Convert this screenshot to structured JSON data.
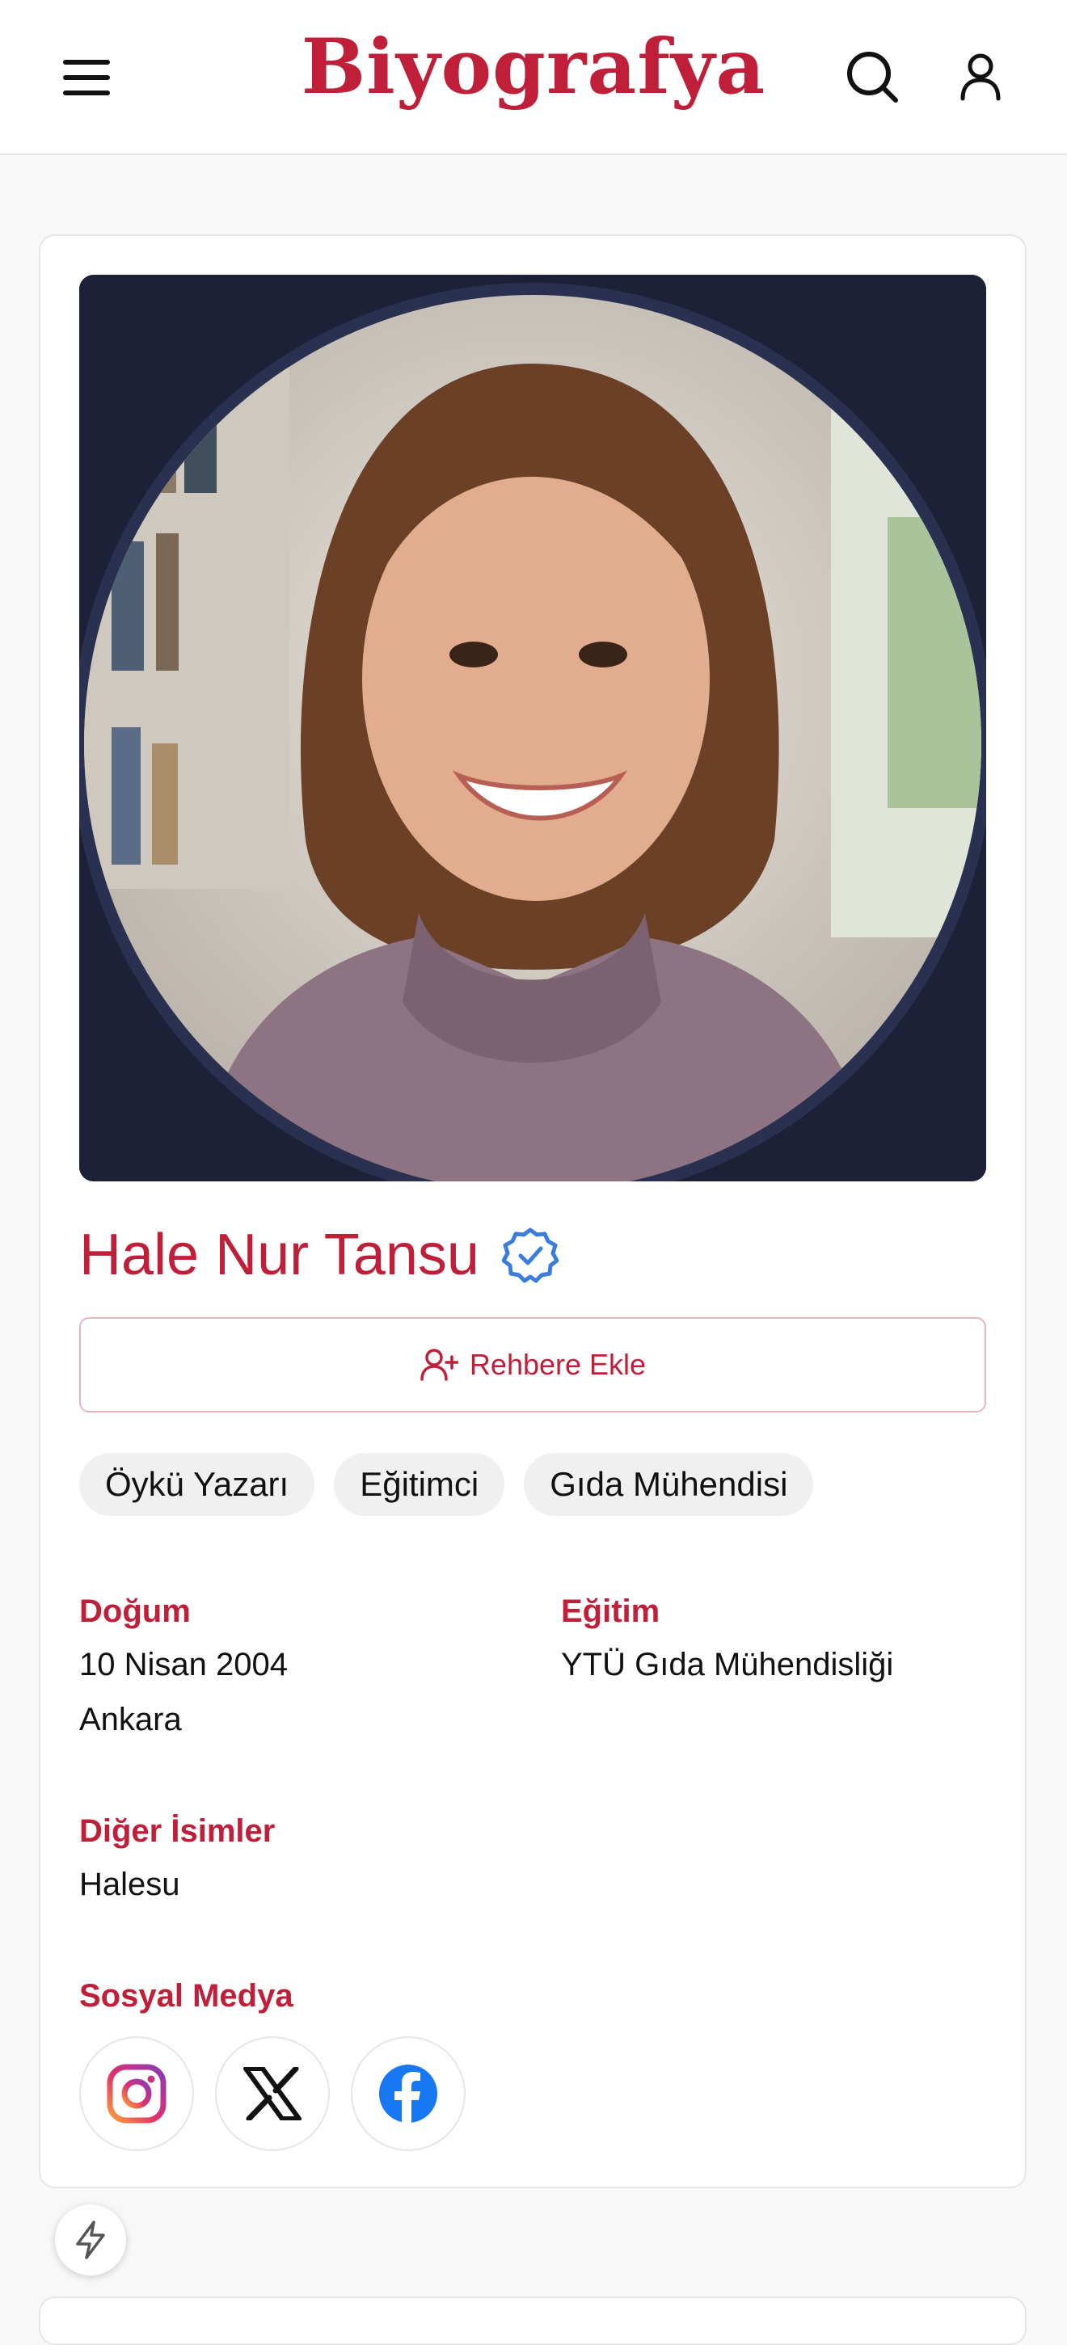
{
  "header": {
    "logo_text": "Biyografya",
    "menu_icon": "hamburger-menu-icon",
    "search_icon": "search-icon",
    "profile_icon": "user-icon"
  },
  "profile": {
    "name": "Hale Nur Tansu",
    "verified_icon": "verified-badge-icon",
    "add_contact_label": "Rehbere Ekle",
    "add_contact_icon": "user-plus-icon",
    "tags": [
      "Öykü Yazarı",
      "Eğitimci",
      "Gıda Mühendisi"
    ],
    "birth": {
      "label": "Doğum",
      "date": "10 Nisan 2004",
      "place": "Ankara"
    },
    "education": {
      "label": "Eğitim",
      "value": "YTÜ Gıda Mühendisliği"
    },
    "other_names": {
      "label": "Diğer İsimler",
      "value": "Halesu"
    },
    "social": {
      "label": "Sosyal Medya",
      "items": [
        {
          "name": "Instagram",
          "icon": "instagram-icon"
        },
        {
          "name": "X",
          "icon": "x-icon"
        },
        {
          "name": "Facebook",
          "icon": "facebook-icon"
        }
      ]
    }
  },
  "floating_button": {
    "icon": "lightning-icon"
  },
  "colors": {
    "brand": "#c01f3a",
    "verified": "#3b7ddd",
    "facebook": "#1877f2",
    "photo_background": "#1c2137"
  }
}
